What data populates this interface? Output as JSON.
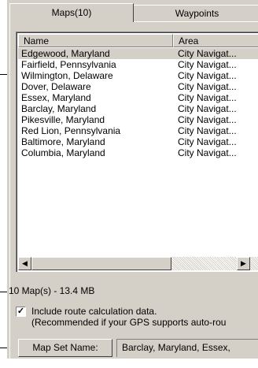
{
  "tabs": [
    {
      "label": "Maps(10)",
      "selected": true
    },
    {
      "label": "Waypoints",
      "selected": false
    }
  ],
  "list": {
    "columns": [
      "Name",
      "Area"
    ],
    "rows": [
      {
        "name": "Edgewood, Maryland",
        "area": "City Navigat...",
        "selected": true
      },
      {
        "name": "Fairfield, Pennsylvania",
        "area": "City Navigat..."
      },
      {
        "name": "Wilmington, Delaware",
        "area": "City Navigat..."
      },
      {
        "name": "Dover, Delaware",
        "area": "City Navigat..."
      },
      {
        "name": "Essex,  Maryland",
        "area": "City Navigat..."
      },
      {
        "name": "Barclay, Maryland",
        "area": "City Navigat..."
      },
      {
        "name": "Pikesville, Maryland",
        "area": "City Navigat..."
      },
      {
        "name": "Red Lion, Pennsylvania",
        "area": "City Navigat..."
      },
      {
        "name": "Baltimore, Maryland",
        "area": "City Navigat..."
      },
      {
        "name": "Columbia, Maryland",
        "area": "City Navigat..."
      }
    ],
    "scroll_left_icon": "arrow-left-icon",
    "scroll_right_icon": "arrow-right-icon"
  },
  "summary": "10 Map(s) - 13.4 MB",
  "route_option": {
    "checked": true,
    "line1": "Include route calculation data.",
    "line2": "(Recommended if your GPS supports auto-rou"
  },
  "mapset": {
    "button_label": "Map Set Name:",
    "value": "Barclay, Maryland, Essex,"
  },
  "colors": {
    "dialog_face": "#d4d0c8",
    "callout_line": "#000000"
  }
}
